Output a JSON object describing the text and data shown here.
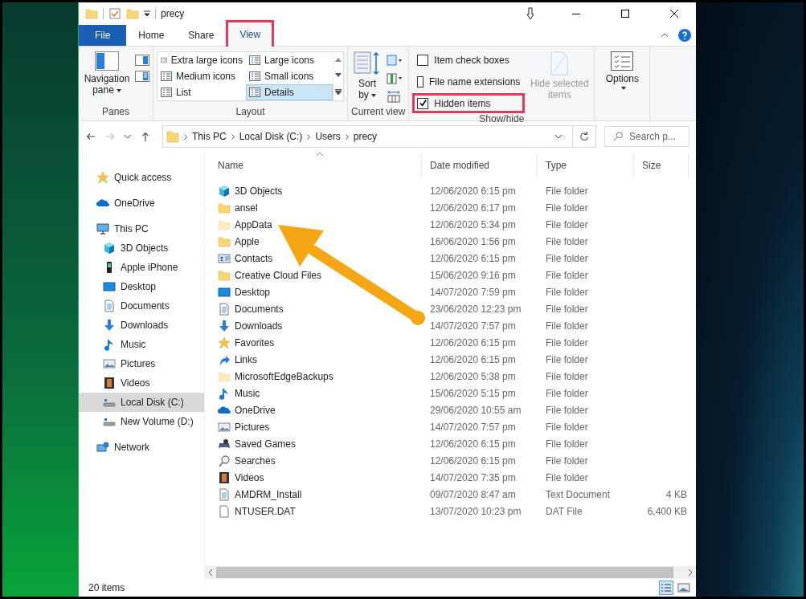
{
  "window": {
    "title": "precy"
  },
  "tabs": [
    {
      "label": "File",
      "kind": "file",
      "selected": false,
      "highlighted": false
    },
    {
      "label": "Home",
      "kind": "tab",
      "selected": false,
      "highlighted": false
    },
    {
      "label": "Share",
      "kind": "tab",
      "selected": false,
      "highlighted": false
    },
    {
      "label": "View",
      "kind": "tab",
      "selected": true,
      "highlighted": true
    }
  ],
  "ribbon": {
    "panes": {
      "button": "Navigation pane",
      "group": "Panes"
    },
    "layout": {
      "group": "Layout",
      "options": [
        {
          "label": "Extra large icons",
          "selected": false
        },
        {
          "label": "Large icons",
          "selected": false
        },
        {
          "label": "Medium icons",
          "selected": false
        },
        {
          "label": "Small icons",
          "selected": false
        },
        {
          "label": "List",
          "selected": false
        },
        {
          "label": "Details",
          "selected": true
        }
      ]
    },
    "current_view": {
      "sort": "Sort by",
      "group": "Current view"
    },
    "show_hide": {
      "group": "Show/hide",
      "checkboxes": [
        {
          "label": "Item check boxes",
          "checked": false,
          "highlighted": false
        },
        {
          "label": "File name extensions",
          "checked": false,
          "highlighted": false
        },
        {
          "label": "Hidden items",
          "checked": true,
          "highlighted": true
        }
      ],
      "hide_selected": {
        "label": "Hide selected items",
        "disabled": true
      }
    },
    "options": "Options"
  },
  "address": {
    "crumbs": [
      "This PC",
      "Local Disk (C:)",
      "Users",
      "precy"
    ]
  },
  "search": {
    "placeholder": "Search p..."
  },
  "nav": [
    {
      "label": "Quick access",
      "kind": "star",
      "selected": false
    },
    {
      "label": "OneDrive",
      "kind": "cloud",
      "selected": false
    },
    {
      "label": "This PC",
      "kind": "pc",
      "selected": false,
      "children": [
        {
          "label": "3D Objects",
          "kind": "cube",
          "selected": false
        },
        {
          "label": "Apple iPhone",
          "kind": "phone",
          "selected": false
        },
        {
          "label": "Desktop",
          "kind": "desktop",
          "selected": false
        },
        {
          "label": "Documents",
          "kind": "document",
          "selected": false
        },
        {
          "label": "Downloads",
          "kind": "download",
          "selected": false
        },
        {
          "label": "Music",
          "kind": "music",
          "selected": false
        },
        {
          "label": "Pictures",
          "kind": "picture",
          "selected": false
        },
        {
          "label": "Videos",
          "kind": "video",
          "selected": false
        },
        {
          "label": "Local Disk (C:)",
          "kind": "drive",
          "selected": true
        },
        {
          "label": "New Volume (D:)",
          "kind": "drive",
          "selected": false
        }
      ]
    },
    {
      "label": "Network",
      "kind": "network",
      "selected": false
    }
  ],
  "columns": [
    "Name",
    "Date modified",
    "Type",
    "Size"
  ],
  "rows": [
    {
      "name": "3D Objects",
      "date": "12/06/2020 6:15 pm",
      "type": "File folder",
      "kind": "cube",
      "hidden": false
    },
    {
      "name": "ansel",
      "date": "12/06/2020 6:17 pm",
      "type": "File folder",
      "kind": "folder",
      "hidden": false
    },
    {
      "name": "AppData",
      "date": "12/06/2020 5:34 pm",
      "type": "File folder",
      "kind": "folder",
      "hidden": true
    },
    {
      "name": "Apple",
      "date": "16/06/2020 1:56 pm",
      "type": "File folder",
      "kind": "folder",
      "hidden": false
    },
    {
      "name": "Contacts",
      "date": "12/06/2020 6:15 pm",
      "type": "File folder",
      "kind": "contacts",
      "hidden": false
    },
    {
      "name": "Creative Cloud Files",
      "date": "15/06/2020 9:16 pm",
      "type": "File folder",
      "kind": "folder",
      "hidden": false
    },
    {
      "name": "Desktop",
      "date": "14/07/2020 7:59 pm",
      "type": "File folder",
      "kind": "desktop",
      "hidden": false
    },
    {
      "name": "Documents",
      "date": "23/06/2020 12:23 pm",
      "type": "File folder",
      "kind": "document",
      "hidden": false
    },
    {
      "name": "Downloads",
      "date": "14/07/2020 7:57 pm",
      "type": "File folder",
      "kind": "download",
      "hidden": false
    },
    {
      "name": "Favorites",
      "date": "12/06/2020 6:15 pm",
      "type": "File folder",
      "kind": "star",
      "hidden": false
    },
    {
      "name": "Links",
      "date": "12/06/2020 6:15 pm",
      "type": "File folder",
      "kind": "link",
      "hidden": false
    },
    {
      "name": "MicrosoftEdgeBackups",
      "date": "12/06/2020 5:38 pm",
      "type": "File folder",
      "kind": "folder",
      "hidden": true
    },
    {
      "name": "Music",
      "date": "15/06/2020 5:15 pm",
      "type": "File folder",
      "kind": "music",
      "hidden": false
    },
    {
      "name": "OneDrive",
      "date": "29/06/2020 10:55 am",
      "type": "File folder",
      "kind": "cloud",
      "hidden": false
    },
    {
      "name": "Pictures",
      "date": "14/07/2020 7:57 pm",
      "type": "File folder",
      "kind": "picture",
      "hidden": false
    },
    {
      "name": "Saved Games",
      "date": "12/06/2020 6:15 pm",
      "type": "File folder",
      "kind": "games",
      "hidden": false
    },
    {
      "name": "Searches",
      "date": "12/06/2020 6:15 pm",
      "type": "File folder",
      "kind": "search",
      "hidden": false
    },
    {
      "name": "Videos",
      "date": "14/07/2020 7:35 pm",
      "type": "File folder",
      "kind": "video",
      "hidden": false
    },
    {
      "name": "AMDRM_Install",
      "date": "09/07/2020 8:47 am",
      "type": "Text Document",
      "size": "4 KB",
      "kind": "text",
      "hidden": false
    },
    {
      "name": "NTUSER.DAT",
      "date": "13/07/2020 10:23 pm",
      "type": "DAT File",
      "size": "6,400 KB",
      "kind": "file",
      "hidden": false
    }
  ],
  "status": "20 items"
}
